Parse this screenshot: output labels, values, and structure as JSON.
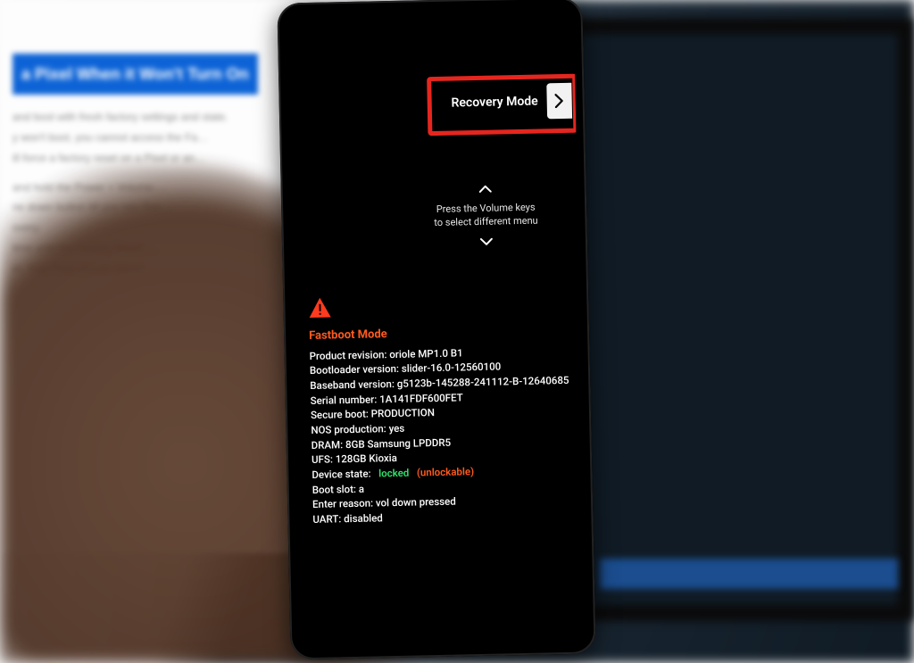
{
  "background": {
    "article_headline": "a Pixel When it Won't Turn On",
    "article_blur_lines": [
      "and boot with fresh factory settings and state.",
      "",
      "y won't boot, you cannot access the Fa…",
      "ill force a factory reset on a Pixel or an…",
      "",
      "and hold the Power + Volume-…",
      "ne down button till you see Rec…",
      "overy.",
      "time until the Factory Reset …",
      "et. Your Pixel should reboot…"
    ]
  },
  "phone": {
    "recovery": {
      "label": "Recovery Mode"
    },
    "volume_hint": {
      "line1": "Press the Volume keys",
      "line2": "to select different menu"
    },
    "fastboot": {
      "title": "Fastboot Mode",
      "rows": {
        "product_revision_k": "Product revision:",
        "product_revision_v": "oriole MP1.0 B1",
        "bootloader_k": "Bootloader version:",
        "bootloader_v": "slider-16.0-12560100",
        "baseband_k": "Baseband version:",
        "baseband_v": "g5123b-145288-241112-B-12640685",
        "serial_k": "Serial number:",
        "serial_v": "1A141FDF600FET",
        "secure_boot_k": "Secure boot:",
        "secure_boot_v": "PRODUCTION",
        "nos_k": "NOS production:",
        "nos_v": "yes",
        "dram_k": "DRAM:",
        "dram_v": "8GB Samsung LPDDR5",
        "ufs_k": "UFS:",
        "ufs_v": "128GB Kioxia",
        "device_state_k": "Device state:",
        "device_state_locked": "locked",
        "device_state_unlockable": "(unlockable)",
        "boot_slot_k": "Boot slot:",
        "boot_slot_v": "a",
        "enter_reason_k": "Enter reason:",
        "enter_reason_v": "vol down pressed",
        "uart_k": "UART:",
        "uart_v": "disabled"
      }
    }
  },
  "colors": {
    "annotation_red": "#e5261f",
    "fastboot_orange": "#ff5a1f",
    "locked_green": "#2fe26b"
  }
}
